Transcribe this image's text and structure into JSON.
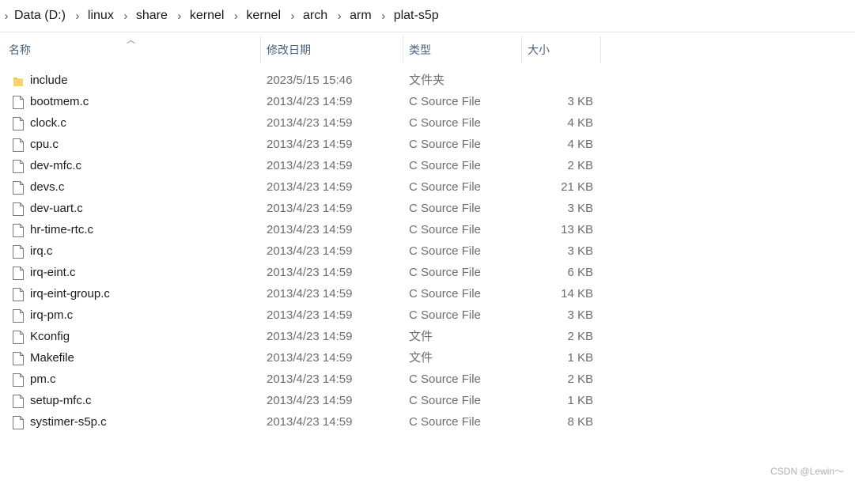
{
  "breadcrumb": [
    "Data (D:)",
    "linux",
    "share",
    "kernel",
    "kernel",
    "arch",
    "arm",
    "plat-s5p"
  ],
  "columns": {
    "name": "名称",
    "date": "修改日期",
    "type": "类型",
    "size": "大小"
  },
  "files": [
    {
      "name": "include",
      "date": "2023/5/15 15:46",
      "type": "文件夹",
      "size": "",
      "icon": "folder-icon"
    },
    {
      "name": "bootmem.c",
      "date": "2013/4/23 14:59",
      "type": "C Source File",
      "size": "3 KB",
      "icon": "file-icon"
    },
    {
      "name": "clock.c",
      "date": "2013/4/23 14:59",
      "type": "C Source File",
      "size": "4 KB",
      "icon": "file-icon"
    },
    {
      "name": "cpu.c",
      "date": "2013/4/23 14:59",
      "type": "C Source File",
      "size": "4 KB",
      "icon": "file-icon"
    },
    {
      "name": "dev-mfc.c",
      "date": "2013/4/23 14:59",
      "type": "C Source File",
      "size": "2 KB",
      "icon": "file-icon"
    },
    {
      "name": "devs.c",
      "date": "2013/4/23 14:59",
      "type": "C Source File",
      "size": "21 KB",
      "icon": "file-icon"
    },
    {
      "name": "dev-uart.c",
      "date": "2013/4/23 14:59",
      "type": "C Source File",
      "size": "3 KB",
      "icon": "file-icon"
    },
    {
      "name": "hr-time-rtc.c",
      "date": "2013/4/23 14:59",
      "type": "C Source File",
      "size": "13 KB",
      "icon": "file-icon"
    },
    {
      "name": "irq.c",
      "date": "2013/4/23 14:59",
      "type": "C Source File",
      "size": "3 KB",
      "icon": "file-icon"
    },
    {
      "name": "irq-eint.c",
      "date": "2013/4/23 14:59",
      "type": "C Source File",
      "size": "6 KB",
      "icon": "file-icon"
    },
    {
      "name": "irq-eint-group.c",
      "date": "2013/4/23 14:59",
      "type": "C Source File",
      "size": "14 KB",
      "icon": "file-icon"
    },
    {
      "name": "irq-pm.c",
      "date": "2013/4/23 14:59",
      "type": "C Source File",
      "size": "3 KB",
      "icon": "file-icon"
    },
    {
      "name": "Kconfig",
      "date": "2013/4/23 14:59",
      "type": "文件",
      "size": "2 KB",
      "icon": "file-icon"
    },
    {
      "name": "Makefile",
      "date": "2013/4/23 14:59",
      "type": "文件",
      "size": "1 KB",
      "icon": "file-icon"
    },
    {
      "name": "pm.c",
      "date": "2013/4/23 14:59",
      "type": "C Source File",
      "size": "2 KB",
      "icon": "file-icon"
    },
    {
      "name": "setup-mfc.c",
      "date": "2013/4/23 14:59",
      "type": "C Source File",
      "size": "1 KB",
      "icon": "file-icon"
    },
    {
      "name": "systimer-s5p.c",
      "date": "2013/4/23 14:59",
      "type": "C Source File",
      "size": "8 KB",
      "icon": "file-icon"
    }
  ],
  "watermark": "CSDN @Lewin～",
  "colors": {
    "folder": "#f3c64a",
    "header_text": "#4c607a",
    "meta_text": "#6d6d6d"
  }
}
